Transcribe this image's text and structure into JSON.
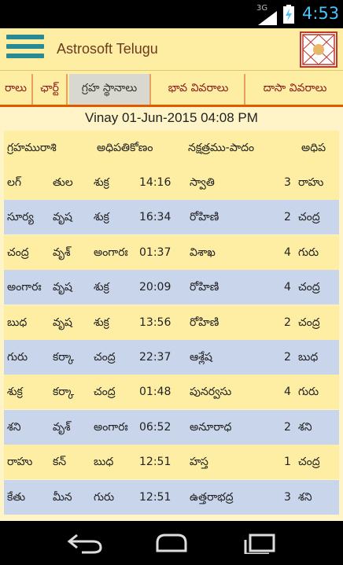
{
  "status": {
    "network": "3G",
    "time": "4:53"
  },
  "app": {
    "title": "Astrosoft Telugu"
  },
  "tabs": [
    {
      "label": "రాలు"
    },
    {
      "label": "ఛార్ట్"
    },
    {
      "label": "గ్రహ స్థానాలు"
    },
    {
      "label": "భావ వివరాలు"
    },
    {
      "label": "దాసా వివరాలు"
    }
  ],
  "chart_title": "Vinay 01-Jun-2015 04:08 PM",
  "table": {
    "headers": [
      "గ్రహమురాశి",
      "అధిపతికోణం",
      "నక్షత్రము-పాదం",
      "అధిప"
    ],
    "rows": [
      [
        "లగ్",
        "తుల",
        "శుక్ర",
        "14:16",
        "స్వాతి",
        "3",
        "రాహు"
      ],
      [
        "సూర్య",
        "వృష",
        "శుక్ర",
        "16:34",
        "రోహిణి",
        "2",
        "చంద్ర"
      ],
      [
        "చంద్ర",
        "వృశ్",
        "అంగారః",
        "01:37",
        "విశాఖ",
        "4",
        "గురు"
      ],
      [
        "అంగారః",
        "వృష",
        "శుక్ర",
        "20:09",
        "రోహిణి",
        "4",
        "చంద్ర"
      ],
      [
        "బుధ",
        "వృష",
        "శుక్ర",
        "13:56",
        "రోహిణి",
        "2",
        "చంద్ర"
      ],
      [
        "గురు",
        "కర్కా",
        "చంద్ర",
        "22:37",
        "ఆశ్లేష",
        "2",
        "బుధ"
      ],
      [
        "శుక్ర",
        "కర్కా",
        "చంద్ర",
        "01:48",
        "పునర్వసు",
        "4",
        "గురు"
      ],
      [
        "శని",
        "వృశ్",
        "అంగారః",
        "06:52",
        "అనూరాధ",
        "2",
        "శని"
      ],
      [
        "రాహు",
        "కన్",
        "బుధ",
        "12:51",
        "హస్త",
        "1",
        "చంద్ర"
      ],
      [
        "కేతు",
        "మీన",
        "గురు",
        "12:51",
        "ఉత్తరాభద్ర",
        "3",
        "శని"
      ]
    ]
  },
  "colors": {
    "header_bg": "#fdeea3",
    "row_alt": "#c9d5ea",
    "tab_text": "#8b1a1a",
    "accent": "#e05a00"
  }
}
